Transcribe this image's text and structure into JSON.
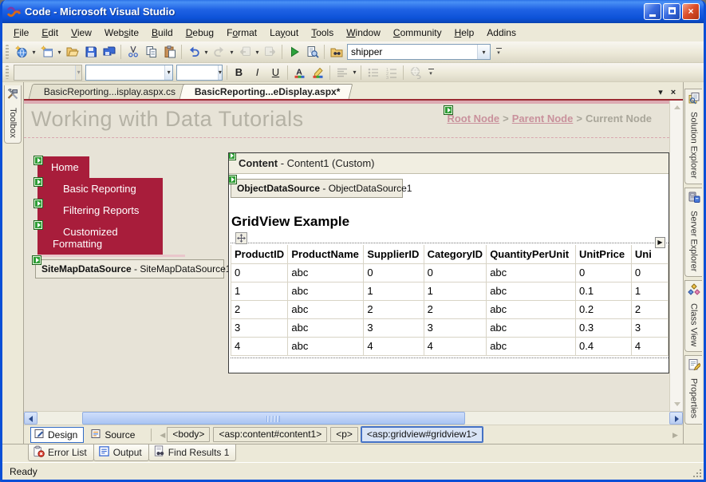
{
  "window": {
    "title": "Code - Microsoft Visual Studio",
    "buttons": {
      "minimize": "minimize",
      "maximize": "maximize",
      "close": "close"
    }
  },
  "menu": {
    "items": [
      {
        "label": "File",
        "key": 0
      },
      {
        "label": "Edit",
        "key": 0
      },
      {
        "label": "View",
        "key": 0
      },
      {
        "label": "Website",
        "key": 3
      },
      {
        "label": "Build",
        "key": 0
      },
      {
        "label": "Debug",
        "key": 0
      },
      {
        "label": "Format",
        "key": 1
      },
      {
        "label": "Layout",
        "key": 2
      },
      {
        "label": "Tools",
        "key": 0
      },
      {
        "label": "Window",
        "key": 0
      },
      {
        "label": "Community",
        "key": 0
      },
      {
        "label": "Help",
        "key": 0
      },
      {
        "label": "Addins",
        "key": -1
      }
    ]
  },
  "toolbar": {
    "find_value": "shipper",
    "items": [
      {
        "icon": "new-website",
        "dd": true
      },
      {
        "icon": "add-item",
        "dd": true
      },
      {
        "icon": "open"
      },
      {
        "icon": "save"
      },
      {
        "icon": "save-all"
      },
      {
        "sep": true
      },
      {
        "icon": "cut"
      },
      {
        "icon": "copy"
      },
      {
        "icon": "paste"
      },
      {
        "sep": true
      },
      {
        "icon": "undo",
        "dd": true
      },
      {
        "icon": "redo",
        "dd": true,
        "disabled": true
      },
      {
        "icon": "nav-back",
        "dd": true,
        "disabled": true
      },
      {
        "icon": "nav-forward",
        "disabled": true
      },
      {
        "sep": true
      },
      {
        "icon": "start-debug"
      },
      {
        "icon": "find-symbol"
      },
      {
        "sep": true
      },
      {
        "icon": "find-in-files"
      },
      {
        "combo": "find"
      },
      {
        "overflow": true
      }
    ]
  },
  "format_toolbar": {
    "bold": "B",
    "italic": "I",
    "underline": "U",
    "items": [
      {
        "combo": "style",
        "disabled": true
      },
      {
        "combo": "font"
      },
      {
        "combo": "size"
      },
      {
        "sep": true
      },
      {
        "text": "bold"
      },
      {
        "text": "italic"
      },
      {
        "text": "underline"
      },
      {
        "sep": true
      },
      {
        "icon": "font-color"
      },
      {
        "icon": "highlight"
      },
      {
        "sep": true
      },
      {
        "icon": "align",
        "dd": true,
        "disabled": true
      },
      {
        "sep": true
      },
      {
        "icon": "bullet-list",
        "disabled": true
      },
      {
        "icon": "numbered-list",
        "disabled": true
      },
      {
        "sep": true
      },
      {
        "icon": "hyperlink",
        "disabled": true
      },
      {
        "overflow": true
      }
    ]
  },
  "document_tabs": [
    {
      "label": "BasicReporting...isplay.aspx.cs",
      "active": false
    },
    {
      "label": "BasicReporting...eDisplay.aspx*",
      "active": true
    }
  ],
  "side_left": {
    "toolbox_label": "Toolbox"
  },
  "side_right": {
    "tabs": [
      {
        "label": "Solution Explorer",
        "icon": "solution-explorer"
      },
      {
        "label": "Server Explorer",
        "icon": "server-explorer"
      },
      {
        "label": "Class View",
        "icon": "class-view"
      },
      {
        "label": "Properties",
        "icon": "properties"
      }
    ]
  },
  "designer": {
    "page_title": "Working with Data Tutorials",
    "breadcrumb": {
      "separator": ">",
      "items": [
        {
          "label": "Root Node",
          "link": true
        },
        {
          "label": "Parent Node",
          "link": true
        },
        {
          "label": "Current Node",
          "link": false
        }
      ]
    },
    "nav_menu": [
      "Home",
      "Basic Reporting",
      "Filtering Reports",
      "Customized Formatting"
    ],
    "sitemap_datasource": {
      "control": "SiteMapDataSource",
      "rest": " - SiteMapDataSource1"
    },
    "content_box": {
      "control": "Content",
      "rest": " - Content1 (Custom)"
    },
    "object_datasource": {
      "control": "ObjectDataSource",
      "rest": " - ObjectDataSource1"
    },
    "gridview": {
      "title": "GridView Example",
      "columns": [
        "ProductID",
        "ProductName",
        "SupplierID",
        "CategoryID",
        "QuantityPerUnit",
        "UnitPrice",
        "Uni"
      ],
      "rows": [
        [
          "0",
          "abc",
          "0",
          "0",
          "abc",
          "0",
          "0"
        ],
        [
          "1",
          "abc",
          "1",
          "1",
          "abc",
          "0.1",
          "1"
        ],
        [
          "2",
          "abc",
          "2",
          "2",
          "abc",
          "0.2",
          "2"
        ],
        [
          "3",
          "abc",
          "3",
          "3",
          "abc",
          "0.3",
          "3"
        ],
        [
          "4",
          "abc",
          "4",
          "4",
          "abc",
          "0.4",
          "4"
        ]
      ]
    }
  },
  "designer_bottom": {
    "design_label": "Design",
    "source_label": "Source",
    "tags": [
      {
        "label": "<body>",
        "selected": false
      },
      {
        "label": "<asp:content#content1>",
        "selected": false
      },
      {
        "label": "<p>",
        "selected": false
      },
      {
        "label": "<asp:gridview#gridview1>",
        "selected": true
      }
    ]
  },
  "bottom_tabs": [
    {
      "label": "Error List",
      "icon": "error-list"
    },
    {
      "label": "Output",
      "icon": "output"
    },
    {
      "label": "Find Results 1",
      "icon": "find-results"
    }
  ],
  "status": "Ready",
  "colors": {
    "titlebar_blue": "#1f62e4",
    "menu_red": "#a81d3b",
    "maroon_line": "#9b2b33",
    "link_pink": "#c9919c",
    "glyph_green": "#2f9e36",
    "page_beige": "#e7e3d7"
  }
}
